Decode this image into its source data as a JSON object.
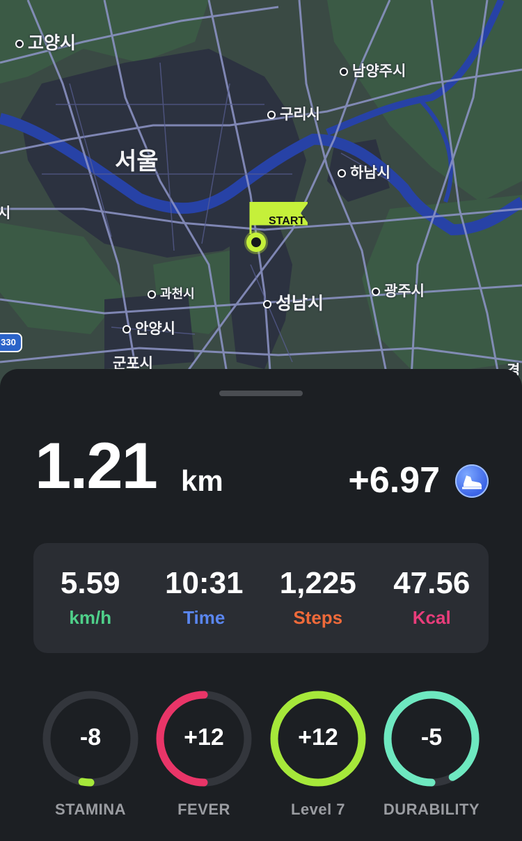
{
  "map": {
    "cities": [
      {
        "name": "고양시",
        "size": "mid"
      },
      {
        "name": "남양주시",
        "size": "sm"
      },
      {
        "name": "구리시",
        "size": "sm"
      },
      {
        "name": "서울",
        "size": "big"
      },
      {
        "name": "하남시",
        "size": "sm"
      },
      {
        "name": "시",
        "size": "sm"
      },
      {
        "name": "과천시",
        "size": "xs"
      },
      {
        "name": "성남시",
        "size": "mid"
      },
      {
        "name": "광주시",
        "size": "sm"
      },
      {
        "name": "안양시",
        "size": "sm"
      },
      {
        "name": "군포시",
        "size": "sm"
      },
      {
        "name": "경",
        "size": "sm"
      }
    ],
    "road_shield": "330",
    "start_label": "START",
    "colors": {
      "land": "#3a4a44",
      "urban": "#2c3240",
      "road": "#8e95c8",
      "river": "#2742a6",
      "start": "#c5f03a"
    }
  },
  "activity": {
    "distance": "1.21",
    "distance_unit": "km",
    "earned": "+6.97",
    "token_icon": "sneaker-token-icon"
  },
  "stats": [
    {
      "value": "5.59",
      "label": "km/h",
      "color": "#4fd08a"
    },
    {
      "value": "10:31",
      "label": "Time",
      "color": "#5a86f0"
    },
    {
      "value": "1,225",
      "label": "Steps",
      "color": "#ef6a3a"
    },
    {
      "value": "47.56",
      "label": "Kcal",
      "color": "#e93d7b"
    }
  ],
  "gauges": [
    {
      "value": "-8",
      "label": "STAMINA",
      "fraction": 0.03,
      "color": "#a6e83a"
    },
    {
      "value": "+12",
      "label": "FEVER",
      "fraction": 0.5,
      "color": "#e93568"
    },
    {
      "value": "+12",
      "label": "Level 7",
      "fraction": 1.0,
      "color": "#a6e83a"
    },
    {
      "value": "-5",
      "label": "DURABILITY",
      "fraction": 0.92,
      "color": "#6ee8c0"
    }
  ]
}
